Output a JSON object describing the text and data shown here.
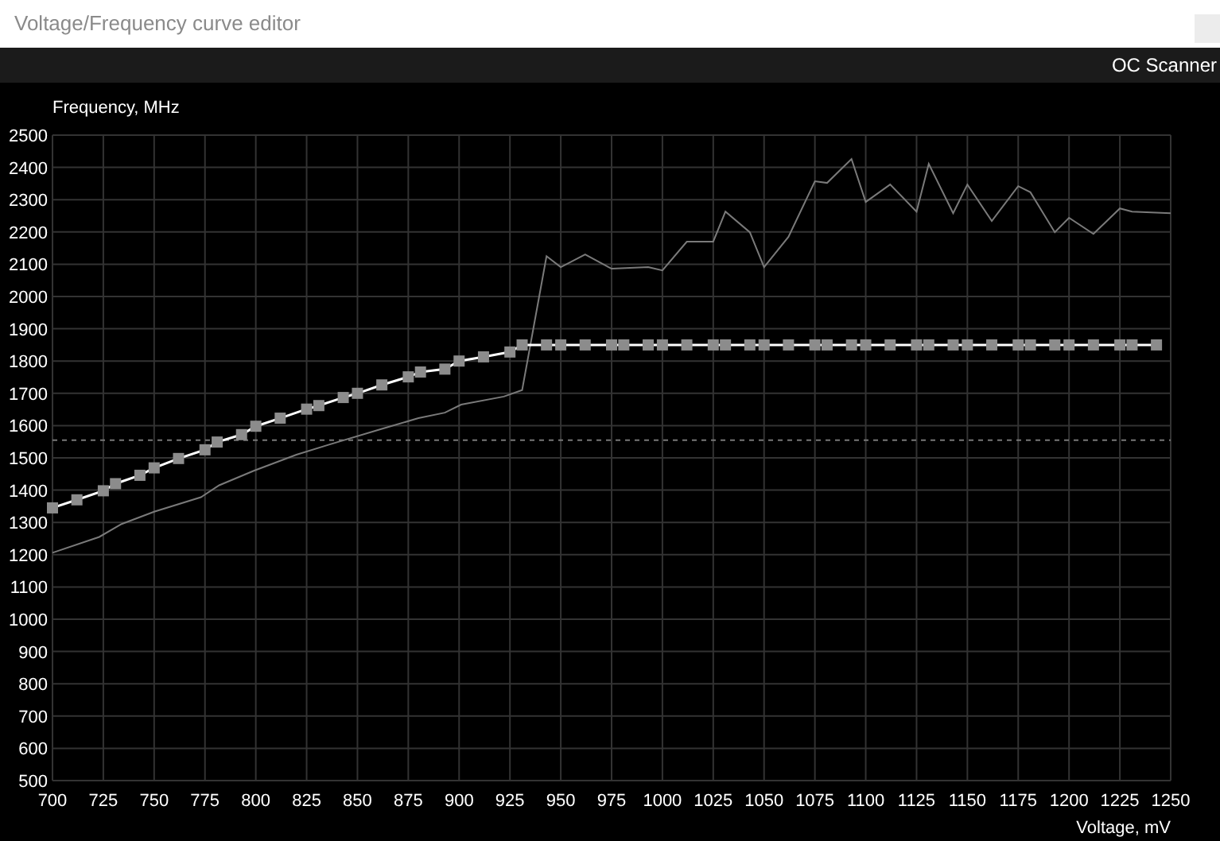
{
  "window": {
    "title": "Voltage/Frequency curve editor"
  },
  "toolbar": {
    "button": "OC Scanner"
  },
  "chart_data": {
    "type": "line",
    "xlabel": "Voltage, mV",
    "ylabel": "Frequency, MHz",
    "xlim": [
      700,
      1250
    ],
    "ylim": [
      500,
      2500
    ],
    "xticks": [
      700,
      725,
      750,
      775,
      800,
      825,
      850,
      875,
      900,
      925,
      950,
      975,
      1000,
      1025,
      1050,
      1075,
      1100,
      1125,
      1150,
      1175,
      1200,
      1225,
      1250
    ],
    "yticks": [
      500,
      600,
      700,
      800,
      900,
      1000,
      1100,
      1200,
      1300,
      1400,
      1500,
      1600,
      1700,
      1800,
      1900,
      2000,
      2100,
      2200,
      2300,
      2400,
      2500
    ],
    "series": [
      {
        "color": "#7a7a7a",
        "x": [
          700,
          723,
          734,
          750,
          773,
          782,
          799,
          820,
          836,
          862,
          880,
          893,
          901,
          922,
          931,
          943,
          950,
          962,
          975,
          993,
          1000,
          1012,
          1025,
          1031,
          1043,
          1050,
          1062,
          1075,
          1081,
          1093,
          1100,
          1112,
          1125,
          1131,
          1143,
          1150,
          1162,
          1175,
          1181,
          1193,
          1200,
          1212,
          1225,
          1231,
          1250
        ],
        "values": [
          1206,
          1255,
          1295,
          1333,
          1378,
          1415,
          1460,
          1510,
          1541,
          1590,
          1623,
          1640,
          1665,
          1690,
          1710,
          2125,
          2091,
          2130,
          2086,
          2091,
          2081,
          2170,
          2170,
          2263,
          2199,
          2091,
          2185,
          2357,
          2352,
          2426,
          2293,
          2347,
          2263,
          2411,
          2258,
          2347,
          2234,
          2342,
          2323,
          2199,
          2244,
          2194,
          2273,
          2263,
          2258
        ]
      },
      {
        "color": "#ffffff",
        "marker": "square",
        "x": [
          700,
          712,
          725,
          731,
          743,
          750,
          762,
          775,
          781,
          793,
          800,
          812,
          825,
          831,
          843,
          850,
          862,
          875,
          881,
          893,
          900,
          912,
          925,
          931,
          943,
          950,
          962,
          975,
          981,
          993,
          1000,
          1012,
          1025,
          1031,
          1043,
          1050,
          1062,
          1075,
          1081,
          1093,
          1100,
          1112,
          1125,
          1131,
          1143,
          1150,
          1162,
          1175,
          1181,
          1193,
          1200,
          1212,
          1225,
          1231,
          1243
        ],
        "values": [
          1345,
          1370,
          1398,
          1420,
          1446,
          1469,
          1498,
          1525,
          1549,
          1572,
          1598,
          1623,
          1651,
          1662,
          1687,
          1700,
          1726,
          1751,
          1766,
          1775,
          1800,
          1813,
          1828,
          1850,
          1850,
          1850,
          1850,
          1850,
          1850,
          1850,
          1850,
          1850,
          1850,
          1850,
          1850,
          1850,
          1850,
          1850,
          1850,
          1850,
          1850,
          1850,
          1850,
          1850,
          1850,
          1850,
          1850,
          1850,
          1850,
          1850,
          1850,
          1850,
          1850,
          1850,
          1850
        ]
      }
    ],
    "grid": true,
    "ref_lines": [
      {
        "axis": "y",
        "value": 1555,
        "color": "#777777"
      }
    ]
  }
}
